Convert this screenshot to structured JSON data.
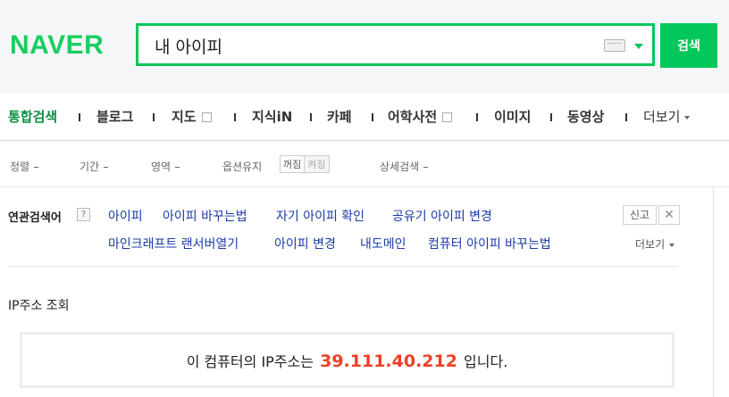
{
  "header": {
    "logo": "NAVER",
    "search_value": "내 아이피",
    "search_button": "검색",
    "colors": {
      "brand": "#03c75a",
      "ip_highlight": "#ed3f24",
      "link": "#1a3ba4"
    }
  },
  "tabs": [
    {
      "label": "통합검색"
    },
    {
      "label": "블로그"
    },
    {
      "label": "지도"
    },
    {
      "label": "지식iN"
    },
    {
      "label": "카페"
    },
    {
      "label": "어학사전"
    },
    {
      "label": "이미지"
    },
    {
      "label": "동영상"
    },
    {
      "label": "더보기"
    }
  ],
  "options": {
    "sort": "정렬",
    "period": "기간",
    "area": "영역",
    "keep_options": "옵션유지",
    "toggle_off": "꺼짐",
    "toggle_on": "켜짐",
    "detail_search": "상세검색"
  },
  "related": {
    "title": "연관검색어",
    "help": "?",
    "row1": [
      "아이피",
      "아이피 바꾸는법",
      "자기 아이피 확인",
      "공유기 아이피 변경"
    ],
    "row2": [
      "마인크래프트 랜서버열기",
      "아이피 변경",
      "내도메인",
      "컴퓨터 아이피 바꾸는법"
    ],
    "report": "신고",
    "close": "✕",
    "more": "더보기"
  },
  "ip": {
    "title": "IP주소 조회",
    "prefix": "이 컴퓨터의 IP주소는",
    "value": "39.111.40.212",
    "suffix": "입니다."
  }
}
